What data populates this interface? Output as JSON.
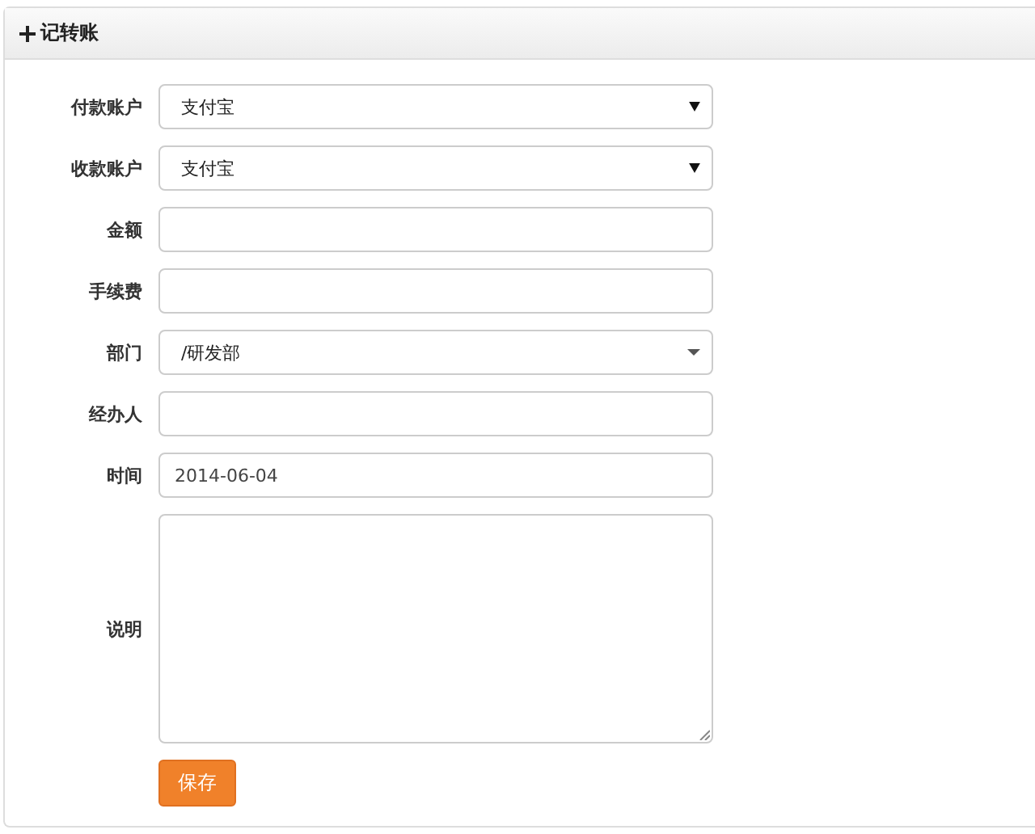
{
  "panel": {
    "title": "记转账"
  },
  "fields": [
    {
      "label": "付款账户",
      "kind": "select",
      "value": "支付宝"
    },
    {
      "label": "收款账户",
      "kind": "select",
      "value": "支付宝"
    },
    {
      "label": "金额",
      "kind": "input"
    },
    {
      "label": "手续费",
      "kind": "input"
    },
    {
      "label": "部门",
      "kind": "dropdown",
      "value": "/研发部"
    },
    {
      "label": "经办人",
      "kind": "input"
    },
    {
      "label": "时间",
      "kind": "input",
      "value": "2014-06-04"
    },
    {
      "label": "说明",
      "kind": "textarea"
    }
  ],
  "buttons": [
    "保存"
  ]
}
